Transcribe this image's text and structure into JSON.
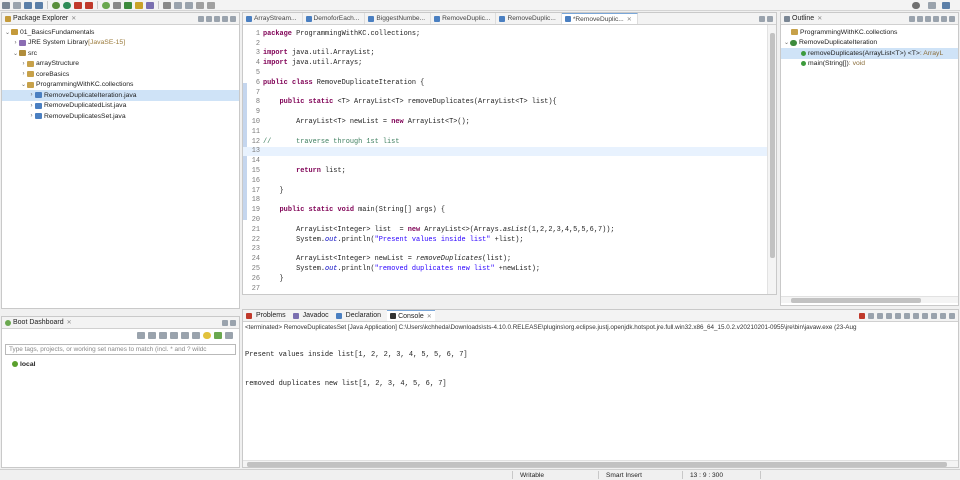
{
  "package_explorer": {
    "title": "Package Explorer",
    "items": [
      {
        "label": "01_BasicsFundamentals",
        "suffix": ""
      },
      {
        "label": "JRE System Library",
        "suffix": " [JavaSE-15]"
      },
      {
        "label": "src",
        "suffix": ""
      },
      {
        "label": "arrayStructure",
        "suffix": ""
      },
      {
        "label": "coreBasics",
        "suffix": ""
      },
      {
        "label": "ProgrammingWithKC.collections",
        "suffix": ""
      },
      {
        "label": "RemoveDuplicateIteration.java",
        "suffix": ""
      },
      {
        "label": "RemoveDuplicatedList.java",
        "suffix": ""
      },
      {
        "label": "RemoveDuplicatesSet.java",
        "suffix": ""
      }
    ]
  },
  "boot_dashboard": {
    "title": "Boot Dashboard",
    "search_placeholder": "Type tags, projects, or working set names to match (incl. * and ? wildc",
    "items": [
      "local"
    ]
  },
  "editor": {
    "tabs": [
      "ArrayStream...",
      "DemoforEach...",
      "BiggestNumbe...",
      "RemoveDuplic...",
      "RemoveDuplic...",
      "*RemoveDuplic..."
    ],
    "active_tab": 5,
    "current_line": "13"
  },
  "outline": {
    "title": "Outline",
    "items": [
      {
        "label": "ProgrammingWithKC.collections",
        "suffix": ""
      },
      {
        "label": "RemoveDuplicateIteration",
        "suffix": ""
      },
      {
        "label": "removeDuplicates(ArrayList<T>) <T>",
        "suffix": " : ArrayL"
      },
      {
        "label": "main(String[])",
        "suffix": " : void"
      }
    ]
  },
  "console": {
    "tabs": [
      "Problems",
      "Javadoc",
      "Declaration",
      "Console"
    ],
    "active_tab": 3,
    "terminated": "<terminated> RemoveDuplicatesSet [Java Application] C:\\Users\\kchheda\\Downloads\\sts-4.10.0.RELEASE\\plugins\\org.eclipse.justj.openjdk.hotspot.jre.full.win32.x86_64_15.0.2.v20210201-0955\\jre\\bin\\javaw.exe  (23-Aug",
    "output": [
      "Present values inside list[1, 2, 2, 3, 4, 5, 5, 6, 7]",
      "removed duplicates new list[1, 2, 3, 4, 5, 6, 7]"
    ]
  },
  "status_bar": {
    "writable": "Writable",
    "insert_mode": "Smart Insert",
    "position": "13 : 9 : 300"
  },
  "colors": {
    "keyword": "#7f0055",
    "comment": "#3f7f5f",
    "string": "#2a00ff",
    "field": "#0000c0",
    "selection": "#cfe3f7",
    "current_line": "#e8f2fe"
  }
}
